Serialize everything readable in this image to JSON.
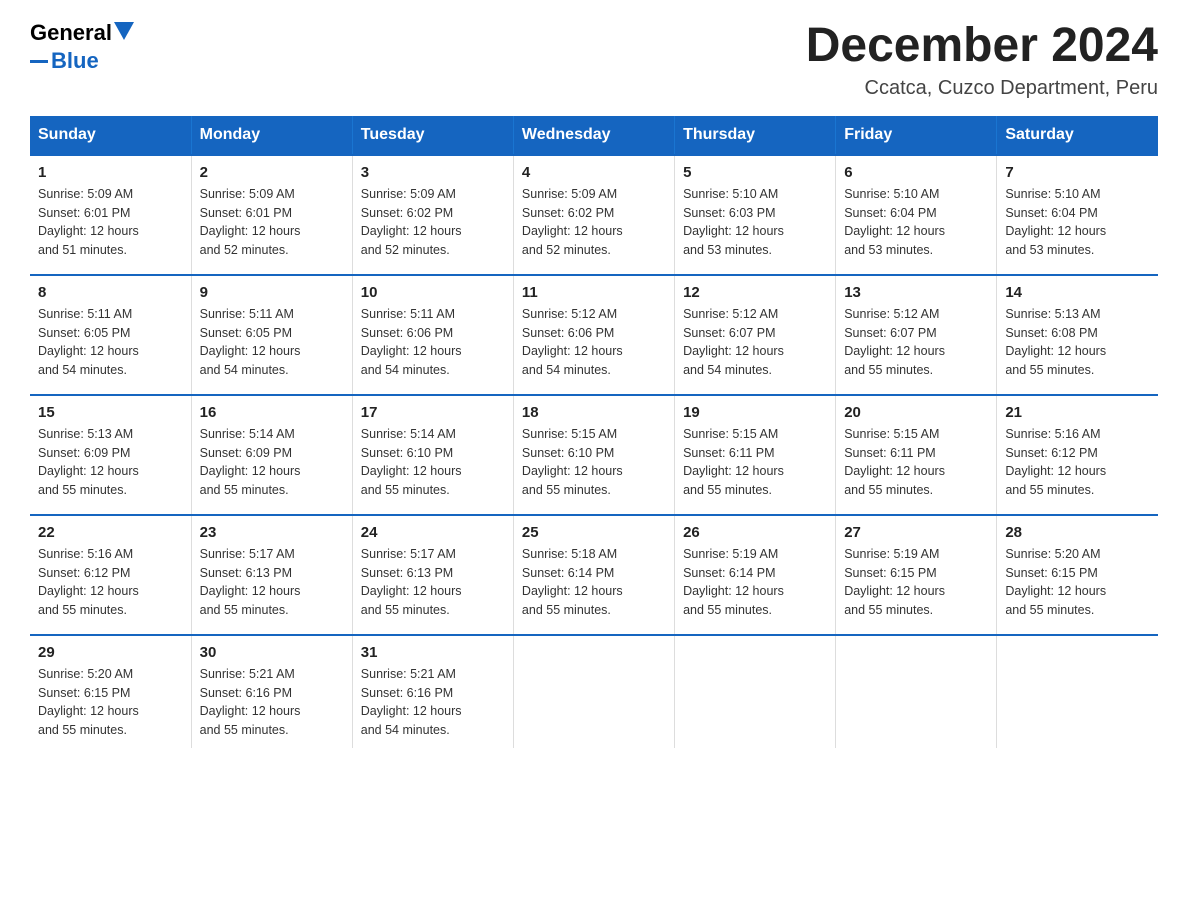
{
  "header": {
    "logo_text_general": "General",
    "logo_text_blue": "Blue",
    "title": "December 2024",
    "subtitle": "Ccatca, Cuzco Department, Peru"
  },
  "days_of_week": [
    "Sunday",
    "Monday",
    "Tuesday",
    "Wednesday",
    "Thursday",
    "Friday",
    "Saturday"
  ],
  "weeks": [
    [
      {
        "day": "1",
        "sunrise": "5:09 AM",
        "sunset": "6:01 PM",
        "daylight": "12 hours and 51 minutes."
      },
      {
        "day": "2",
        "sunrise": "5:09 AM",
        "sunset": "6:01 PM",
        "daylight": "12 hours and 52 minutes."
      },
      {
        "day": "3",
        "sunrise": "5:09 AM",
        "sunset": "6:02 PM",
        "daylight": "12 hours and 52 minutes."
      },
      {
        "day": "4",
        "sunrise": "5:09 AM",
        "sunset": "6:02 PM",
        "daylight": "12 hours and 52 minutes."
      },
      {
        "day": "5",
        "sunrise": "5:10 AM",
        "sunset": "6:03 PM",
        "daylight": "12 hours and 53 minutes."
      },
      {
        "day": "6",
        "sunrise": "5:10 AM",
        "sunset": "6:04 PM",
        "daylight": "12 hours and 53 minutes."
      },
      {
        "day": "7",
        "sunrise": "5:10 AM",
        "sunset": "6:04 PM",
        "daylight": "12 hours and 53 minutes."
      }
    ],
    [
      {
        "day": "8",
        "sunrise": "5:11 AM",
        "sunset": "6:05 PM",
        "daylight": "12 hours and 54 minutes."
      },
      {
        "day": "9",
        "sunrise": "5:11 AM",
        "sunset": "6:05 PM",
        "daylight": "12 hours and 54 minutes."
      },
      {
        "day": "10",
        "sunrise": "5:11 AM",
        "sunset": "6:06 PM",
        "daylight": "12 hours and 54 minutes."
      },
      {
        "day": "11",
        "sunrise": "5:12 AM",
        "sunset": "6:06 PM",
        "daylight": "12 hours and 54 minutes."
      },
      {
        "day": "12",
        "sunrise": "5:12 AM",
        "sunset": "6:07 PM",
        "daylight": "12 hours and 54 minutes."
      },
      {
        "day": "13",
        "sunrise": "5:12 AM",
        "sunset": "6:07 PM",
        "daylight": "12 hours and 55 minutes."
      },
      {
        "day": "14",
        "sunrise": "5:13 AM",
        "sunset": "6:08 PM",
        "daylight": "12 hours and 55 minutes."
      }
    ],
    [
      {
        "day": "15",
        "sunrise": "5:13 AM",
        "sunset": "6:09 PM",
        "daylight": "12 hours and 55 minutes."
      },
      {
        "day": "16",
        "sunrise": "5:14 AM",
        "sunset": "6:09 PM",
        "daylight": "12 hours and 55 minutes."
      },
      {
        "day": "17",
        "sunrise": "5:14 AM",
        "sunset": "6:10 PM",
        "daylight": "12 hours and 55 minutes."
      },
      {
        "day": "18",
        "sunrise": "5:15 AM",
        "sunset": "6:10 PM",
        "daylight": "12 hours and 55 minutes."
      },
      {
        "day": "19",
        "sunrise": "5:15 AM",
        "sunset": "6:11 PM",
        "daylight": "12 hours and 55 minutes."
      },
      {
        "day": "20",
        "sunrise": "5:15 AM",
        "sunset": "6:11 PM",
        "daylight": "12 hours and 55 minutes."
      },
      {
        "day": "21",
        "sunrise": "5:16 AM",
        "sunset": "6:12 PM",
        "daylight": "12 hours and 55 minutes."
      }
    ],
    [
      {
        "day": "22",
        "sunrise": "5:16 AM",
        "sunset": "6:12 PM",
        "daylight": "12 hours and 55 minutes."
      },
      {
        "day": "23",
        "sunrise": "5:17 AM",
        "sunset": "6:13 PM",
        "daylight": "12 hours and 55 minutes."
      },
      {
        "day": "24",
        "sunrise": "5:17 AM",
        "sunset": "6:13 PM",
        "daylight": "12 hours and 55 minutes."
      },
      {
        "day": "25",
        "sunrise": "5:18 AM",
        "sunset": "6:14 PM",
        "daylight": "12 hours and 55 minutes."
      },
      {
        "day": "26",
        "sunrise": "5:19 AM",
        "sunset": "6:14 PM",
        "daylight": "12 hours and 55 minutes."
      },
      {
        "day": "27",
        "sunrise": "5:19 AM",
        "sunset": "6:15 PM",
        "daylight": "12 hours and 55 minutes."
      },
      {
        "day": "28",
        "sunrise": "5:20 AM",
        "sunset": "6:15 PM",
        "daylight": "12 hours and 55 minutes."
      }
    ],
    [
      {
        "day": "29",
        "sunrise": "5:20 AM",
        "sunset": "6:15 PM",
        "daylight": "12 hours and 55 minutes."
      },
      {
        "day": "30",
        "sunrise": "5:21 AM",
        "sunset": "6:16 PM",
        "daylight": "12 hours and 55 minutes."
      },
      {
        "day": "31",
        "sunrise": "5:21 AM",
        "sunset": "6:16 PM",
        "daylight": "12 hours and 54 minutes."
      },
      null,
      null,
      null,
      null
    ]
  ],
  "labels": {
    "sunrise": "Sunrise:",
    "sunset": "Sunset:",
    "daylight": "Daylight:"
  },
  "colors": {
    "header_bg": "#1565C0",
    "header_text": "#ffffff",
    "border": "#1565C0"
  }
}
